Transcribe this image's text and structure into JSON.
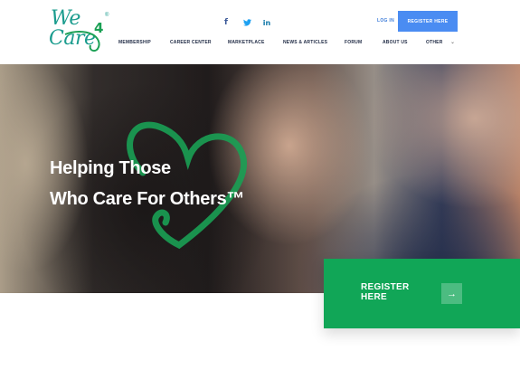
{
  "logo": {
    "line1": "We",
    "line2": "Care",
    "number": "4",
    "reg_mark": "®"
  },
  "social": [
    {
      "name": "facebook",
      "glyph": "f"
    },
    {
      "name": "twitter",
      "glyph": "🐦"
    },
    {
      "name": "linkedin",
      "glyph": "in"
    }
  ],
  "header": {
    "login_label": "LOG IN",
    "register_label": "REGISTER HERE"
  },
  "nav": {
    "items": [
      "MEMBERSHIP",
      "CAREER CENTER",
      "MARKETPLACE",
      "NEWS & ARTICLES",
      "FORUM",
      "ABOUT US",
      "OTHER"
    ]
  },
  "hero": {
    "title_line1": "Helping Those",
    "title_line2": "Who Care For Others™"
  },
  "register_card": {
    "line1": "REGISTER",
    "line2": "HERE",
    "arrow": "→"
  },
  "colors": {
    "brand_teal": "#1b9c8e",
    "brand_green": "#11a657",
    "button_blue": "#4a8cf2",
    "nav_text": "#1f2a44"
  }
}
